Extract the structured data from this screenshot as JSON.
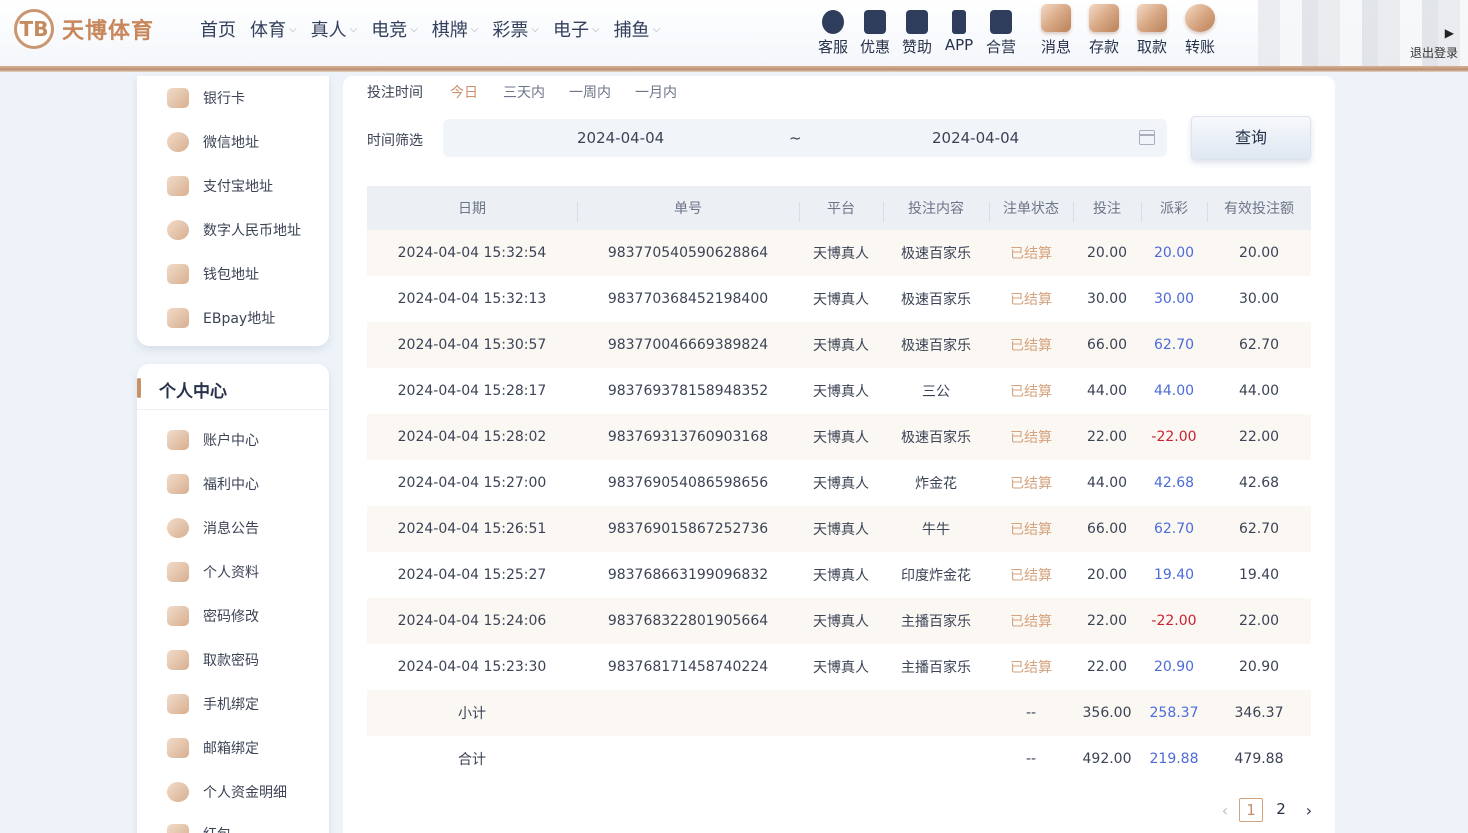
{
  "header": {
    "logo_letters": "TB",
    "logo_text": "天博体育",
    "nav": [
      {
        "label": "首页",
        "has_dropdown": false
      },
      {
        "label": "体育",
        "has_dropdown": true
      },
      {
        "label": "真人",
        "has_dropdown": true
      },
      {
        "label": "电竞",
        "has_dropdown": true
      },
      {
        "label": "棋牌",
        "has_dropdown": true
      },
      {
        "label": "彩票",
        "has_dropdown": true
      },
      {
        "label": "电子",
        "has_dropdown": true
      },
      {
        "label": "捕鱼",
        "has_dropdown": true
      }
    ],
    "shortcuts": [
      {
        "label": "客服",
        "icon": "chat-icon"
      },
      {
        "label": "优惠",
        "icon": "gift-icon"
      },
      {
        "label": "赞助",
        "icon": "star-badge-icon"
      },
      {
        "label": "APP",
        "icon": "phone-icon"
      },
      {
        "label": "合营",
        "icon": "handshake-icon"
      }
    ],
    "money_actions": [
      {
        "label": "消息",
        "icon": "message-icon"
      },
      {
        "label": "存款",
        "icon": "deposit-icon"
      },
      {
        "label": "取款",
        "icon": "withdraw-icon"
      },
      {
        "label": "转账",
        "icon": "transfer-icon"
      }
    ],
    "logout_label": "退出登录"
  },
  "sidebar": {
    "wallet_items": [
      {
        "label": "银行卡",
        "icon": "bank-card-icon"
      },
      {
        "label": "微信地址",
        "icon": "wechat-icon"
      },
      {
        "label": "支付宝地址",
        "icon": "alipay-icon"
      },
      {
        "label": "数字人民币地址",
        "icon": "digital-rmb-icon"
      },
      {
        "label": "钱包地址",
        "icon": "wallet-icon"
      },
      {
        "label": "EBpay地址",
        "icon": "ebpay-icon"
      }
    ],
    "personal_title": "个人中心",
    "personal_items": [
      {
        "label": "账户中心",
        "icon": "account-icon"
      },
      {
        "label": "福利中心",
        "icon": "welfare-icon"
      },
      {
        "label": "消息公告",
        "icon": "bell-icon"
      },
      {
        "label": "个人资料",
        "icon": "profile-icon"
      },
      {
        "label": "密码修改",
        "icon": "lock-icon"
      },
      {
        "label": "取款密码",
        "icon": "key-lock-icon"
      },
      {
        "label": "手机绑定",
        "icon": "phone-bind-icon"
      },
      {
        "label": "邮箱绑定",
        "icon": "mail-icon"
      },
      {
        "label": "个人资金明细",
        "icon": "yuan-icon"
      },
      {
        "label": "红包",
        "icon": "red-packet-icon"
      }
    ]
  },
  "filters": {
    "bet_time_label": "投注时间",
    "quick_ranges": [
      "今日",
      "三天内",
      "一周内",
      "一月内"
    ],
    "active_range": "今日",
    "time_filter_label": "时间筛选",
    "start_date": "2024-04-04",
    "separator": "~",
    "end_date": "2024-04-04",
    "query_label": "查询"
  },
  "table": {
    "columns": [
      "日期",
      "单号",
      "平台",
      "投注内容",
      "注单状态",
      "投注",
      "派彩",
      "有效投注额"
    ],
    "rows": [
      {
        "date": "2024-04-04 15:32:54",
        "order": "983770540590628864",
        "platform": "天博真人",
        "content": "极速百家乐",
        "status": "已结算",
        "bet": "20.00",
        "payout": "20.00",
        "valid": "20.00",
        "payout_sign": "pos"
      },
      {
        "date": "2024-04-04 15:32:13",
        "order": "983770368452198400",
        "platform": "天博真人",
        "content": "极速百家乐",
        "status": "已结算",
        "bet": "30.00",
        "payout": "30.00",
        "valid": "30.00",
        "payout_sign": "pos"
      },
      {
        "date": "2024-04-04 15:30:57",
        "order": "983770046669389824",
        "platform": "天博真人",
        "content": "极速百家乐",
        "status": "已结算",
        "bet": "66.00",
        "payout": "62.70",
        "valid": "62.70",
        "payout_sign": "pos"
      },
      {
        "date": "2024-04-04 15:28:17",
        "order": "983769378158948352",
        "platform": "天博真人",
        "content": "三公",
        "status": "已结算",
        "bet": "44.00",
        "payout": "44.00",
        "valid": "44.00",
        "payout_sign": "pos"
      },
      {
        "date": "2024-04-04 15:28:02",
        "order": "983769313760903168",
        "platform": "天博真人",
        "content": "极速百家乐",
        "status": "已结算",
        "bet": "22.00",
        "payout": "-22.00",
        "valid": "22.00",
        "payout_sign": "neg"
      },
      {
        "date": "2024-04-04 15:27:00",
        "order": "983769054086598656",
        "platform": "天博真人",
        "content": "炸金花",
        "status": "已结算",
        "bet": "44.00",
        "payout": "42.68",
        "valid": "42.68",
        "payout_sign": "pos"
      },
      {
        "date": "2024-04-04 15:26:51",
        "order": "983769015867252736",
        "platform": "天博真人",
        "content": "牛牛",
        "status": "已结算",
        "bet": "66.00",
        "payout": "62.70",
        "valid": "62.70",
        "payout_sign": "pos"
      },
      {
        "date": "2024-04-04 15:25:27",
        "order": "983768663199096832",
        "platform": "天博真人",
        "content": "印度炸金花",
        "status": "已结算",
        "bet": "20.00",
        "payout": "19.40",
        "valid": "19.40",
        "payout_sign": "pos"
      },
      {
        "date": "2024-04-04 15:24:06",
        "order": "983768322801905664",
        "platform": "天博真人",
        "content": "主播百家乐",
        "status": "已结算",
        "bet": "22.00",
        "payout": "-22.00",
        "valid": "22.00",
        "payout_sign": "neg"
      },
      {
        "date": "2024-04-04 15:23:30",
        "order": "983768171458740224",
        "platform": "天博真人",
        "content": "主播百家乐",
        "status": "已结算",
        "bet": "22.00",
        "payout": "20.90",
        "valid": "20.90",
        "payout_sign": "pos"
      }
    ],
    "subtotal": {
      "label": "小计",
      "status": "--",
      "bet": "356.00",
      "payout": "258.37",
      "valid": "346.37"
    },
    "total": {
      "label": "合计",
      "status": "--",
      "bet": "492.00",
      "payout": "219.88",
      "valid": "479.88"
    }
  },
  "pagination": {
    "pages": [
      "1",
      "2"
    ],
    "current": "1",
    "prev": "‹",
    "next": "›"
  },
  "colors": {
    "accent": "#c9906a",
    "positive": "#4d6bd8",
    "negative": "#cc2230",
    "status": "#d4a27c"
  }
}
